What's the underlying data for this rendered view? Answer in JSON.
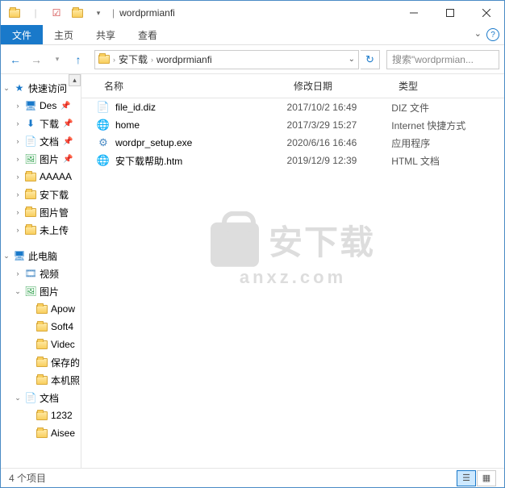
{
  "title": "wordprmianfi",
  "ribbon": {
    "file": "文件",
    "home": "主页",
    "share": "共享",
    "view": "查看"
  },
  "breadcrumbs": [
    "安下载",
    "wordprmianfi"
  ],
  "search_placeholder": "搜索\"wordprmian...",
  "columns": {
    "name": "名称",
    "date": "修改日期",
    "type": "类型"
  },
  "sidebar": {
    "quickaccess": "快速访问",
    "items_qa": [
      {
        "label": "Des",
        "icon": "desktop",
        "pin": true
      },
      {
        "label": "下载",
        "icon": "download",
        "pin": true
      },
      {
        "label": "文档",
        "icon": "doc",
        "pin": true
      },
      {
        "label": "图片",
        "icon": "picture",
        "pin": true
      },
      {
        "label": "AAAAA",
        "icon": "folder"
      },
      {
        "label": "安下载",
        "icon": "folder"
      },
      {
        "label": "图片管",
        "icon": "folder"
      },
      {
        "label": "未上传",
        "icon": "folder"
      }
    ],
    "thispc": "此电脑",
    "items_pc": [
      {
        "label": "视频",
        "icon": "video"
      },
      {
        "label": "图片",
        "icon": "picture",
        "expanded": true
      }
    ],
    "items_pic": [
      {
        "label": "Apow"
      },
      {
        "label": "Soft4"
      },
      {
        "label": "Videc"
      },
      {
        "label": "保存的"
      },
      {
        "label": "本机照"
      }
    ],
    "docs": "文档",
    "items_docs": [
      {
        "label": "1232"
      },
      {
        "label": "Aisee"
      }
    ]
  },
  "files": [
    {
      "name": "file_id.diz",
      "date": "2017/10/2 16:49",
      "type": "DIZ 文件",
      "icon": "file"
    },
    {
      "name": "home",
      "date": "2017/3/29 15:27",
      "type": "Internet 快捷方式",
      "icon": "url"
    },
    {
      "name": "wordpr_setup.exe",
      "date": "2020/6/16 16:46",
      "type": "应用程序",
      "icon": "exe"
    },
    {
      "name": "安下载帮助.htm",
      "date": "2019/12/9 12:39",
      "type": "HTML 文档",
      "icon": "htm"
    }
  ],
  "status": "4 个项目",
  "watermark": {
    "main": "安下载",
    "sub": "anxz.com"
  }
}
